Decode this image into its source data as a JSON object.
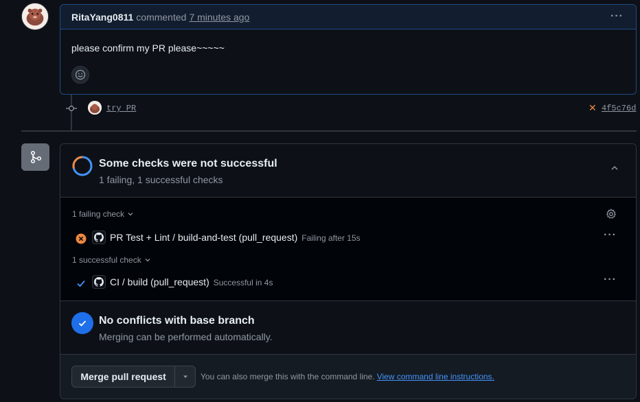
{
  "comment": {
    "author": "RitaYang0811",
    "verb": "commented",
    "time": "7 minutes ago",
    "body": "please confirm my PR please~~~~~",
    "menu_icon": "kebab-horizontal-icon",
    "reaction_icon": "smiley-icon"
  },
  "commit": {
    "message": "try PR",
    "status_icon": "x-icon",
    "status_color": "#f0883e",
    "sha": "4f5c76d"
  },
  "checks": {
    "title": "Some checks were not successful",
    "subtitle": "1 failing, 1 successful checks",
    "failing_group_label": "1 failing check",
    "successful_group_label": "1 successful check",
    "failing": [
      {
        "name": "PR Test + Lint / build-and-test (pull_request)",
        "meta": "Failing after 15s"
      }
    ],
    "successful": [
      {
        "name": "CI / build (pull_request)",
        "meta": "Successful in 4s"
      }
    ],
    "colors": {
      "fail": "#f0883e",
      "success": "#4493f8",
      "ring_success": "#4493f8",
      "ring_fail": "#f0883e"
    }
  },
  "conflicts": {
    "title": "No conflicts with base branch",
    "subtitle": "Merging can be performed automatically."
  },
  "merge": {
    "button_label": "Merge pull request",
    "hint": "You can also merge this with the command line.",
    "link": "View command line instructions."
  }
}
